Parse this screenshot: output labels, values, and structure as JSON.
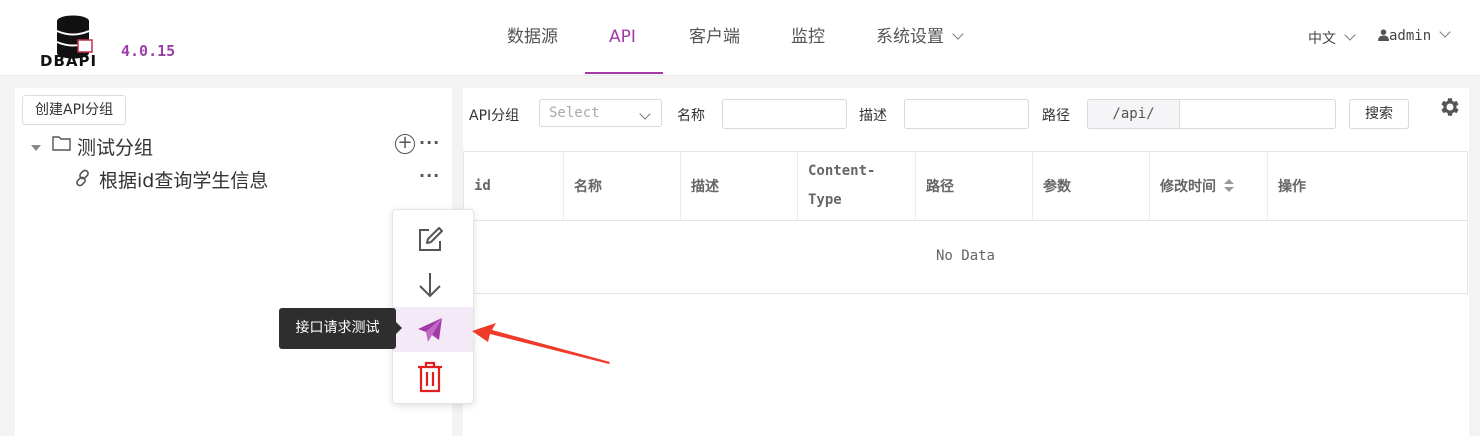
{
  "app": {
    "logo_text": "DBAPI",
    "version": "4.0.15"
  },
  "nav": {
    "items": [
      {
        "label": "数据源",
        "active": false
      },
      {
        "label": "API",
        "active": true
      },
      {
        "label": "客户端",
        "active": false
      },
      {
        "label": "监控",
        "active": false
      },
      {
        "label": "系统设置",
        "active": false,
        "dropdown": true
      }
    ]
  },
  "header_right": {
    "language": "中文",
    "user": "admin"
  },
  "sidebar": {
    "create_button": "创建API分组",
    "group": {
      "label": "测试分组",
      "expanded": true
    },
    "apis": [
      {
        "label": "根据id查询学生信息"
      }
    ]
  },
  "filters": {
    "group_label": "API分组",
    "group_placeholder": "Select",
    "name_label": "名称",
    "desc_label": "描述",
    "path_label": "路径",
    "path_prefix": "/api/",
    "search_button": "搜索"
  },
  "table": {
    "columns": [
      "id",
      "名称",
      "描述",
      "Content-\nType",
      "路径",
      "参数",
      "修改时间",
      "操作"
    ],
    "empty_text": "No Data"
  },
  "context_menu": {
    "items": [
      {
        "icon": "edit-icon"
      },
      {
        "icon": "download-icon"
      },
      {
        "icon": "send-icon",
        "highlighted": true
      },
      {
        "icon": "delete-icon"
      }
    ],
    "tooltip": "接口请求测试"
  },
  "colors": {
    "accent": "#a13aa5",
    "danger": "#e02020",
    "annotation_arrow": "#f03a2a"
  }
}
